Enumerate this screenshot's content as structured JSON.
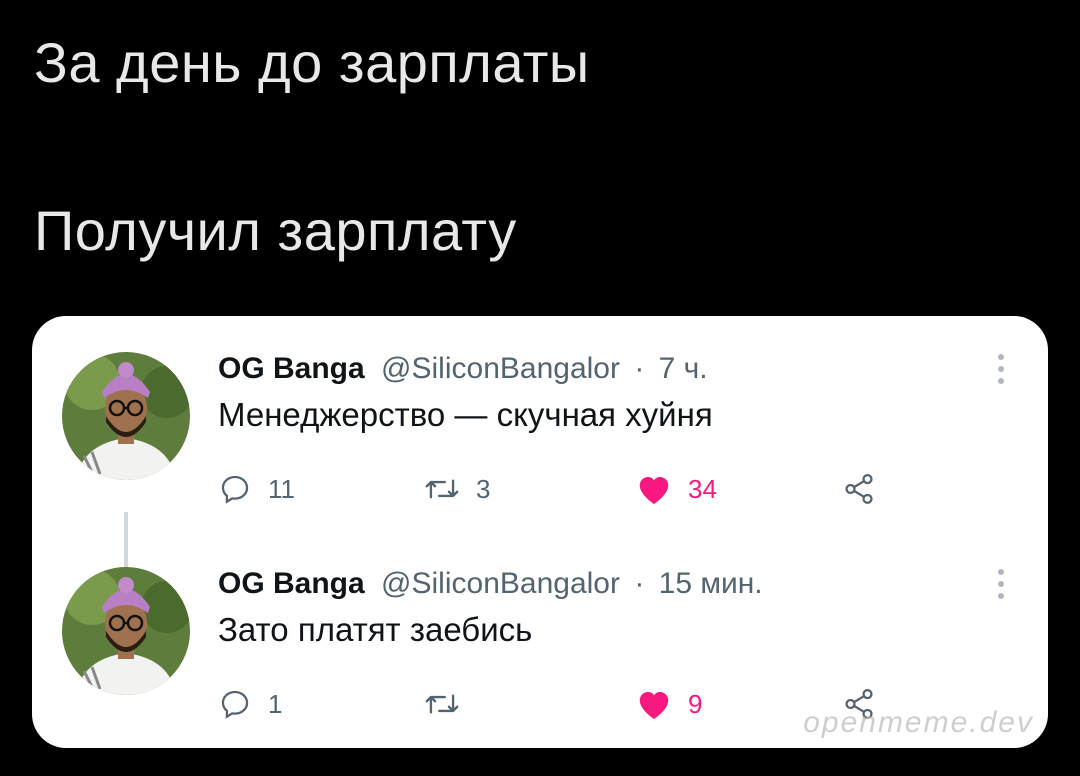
{
  "captions": {
    "top": "За день до зарплаты",
    "bottom": "Получил зарплату"
  },
  "colors": {
    "like": "#f91880",
    "text_secondary": "#536471",
    "background": "#000000",
    "card": "#ffffff"
  },
  "tweets": [
    {
      "name": "OG Banga",
      "handle": "@SiliconBangalor",
      "separator": "·",
      "time": "7 ч.",
      "text": "Менеджерство — скучная хуйня",
      "replies": "11",
      "retweets": "3",
      "likes": "34",
      "liked": true
    },
    {
      "name": "OG Banga",
      "handle": "@SiliconBangalor",
      "separator": "·",
      "time": "15 мин.",
      "text": "Зато платят заебись",
      "replies": "1",
      "retweets": "",
      "likes": "9",
      "liked": true
    }
  ],
  "icons": {
    "reply": "reply-icon",
    "retweet": "retweet-icon",
    "like": "heart-icon",
    "share": "share-icon",
    "more": "more-options-icon"
  },
  "watermark": "openmeme.dev"
}
